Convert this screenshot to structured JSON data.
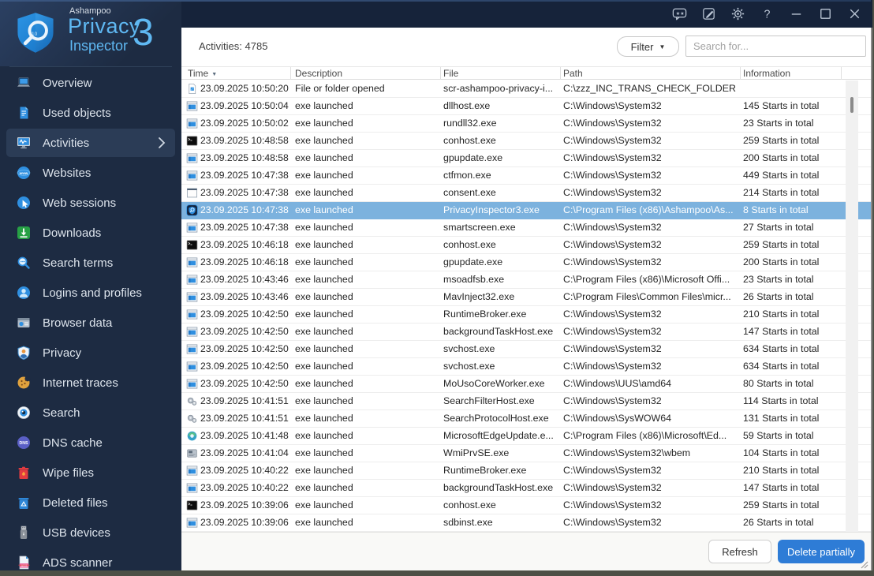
{
  "colors": {
    "accent": "#2e7cd6",
    "selected_row": "#7cb2de",
    "sidebar_bg": "#1d2b42",
    "topbar_bg": "#16233a"
  },
  "logo": {
    "brand": "Ashampoo",
    "line1": "Privacy",
    "line2": "Inspector",
    "version": "3"
  },
  "titlebar": {
    "buttons": [
      {
        "id": "feedback",
        "icon": "feedback-icon"
      },
      {
        "id": "notes",
        "icon": "notes-icon"
      },
      {
        "id": "settings",
        "icon": "gear-icon"
      },
      {
        "id": "help",
        "icon": "help-icon"
      },
      {
        "id": "minimize",
        "icon": "minimize-icon"
      },
      {
        "id": "maximize",
        "icon": "maximize-icon"
      },
      {
        "id": "close",
        "icon": "close-icon"
      }
    ]
  },
  "sidebar": {
    "items": [
      {
        "id": "overview",
        "label": "Overview",
        "icon": "laptop-icon",
        "selected": false
      },
      {
        "id": "used-objects",
        "label": "Used objects",
        "icon": "document-icon",
        "selected": false
      },
      {
        "id": "activities",
        "label": "Activities",
        "icon": "activity-monitor-icon",
        "selected": true
      },
      {
        "id": "websites",
        "label": "Websites",
        "icon": "globe-www-icon",
        "selected": false
      },
      {
        "id": "web-sessions",
        "label": "Web sessions",
        "icon": "cursor-circle-icon",
        "selected": false
      },
      {
        "id": "downloads",
        "label": "Downloads",
        "icon": "download-icon",
        "selected": false
      },
      {
        "id": "search-terms",
        "label": "Search terms",
        "icon": "magnifier-icon",
        "selected": false
      },
      {
        "id": "logins-and-profiles",
        "label": "Logins and profiles",
        "icon": "user-circle-icon",
        "selected": false
      },
      {
        "id": "browser-data",
        "label": "Browser data",
        "icon": "browser-window-icon",
        "selected": false
      },
      {
        "id": "privacy",
        "label": "Privacy",
        "icon": "shield-user-icon",
        "selected": false
      },
      {
        "id": "internet-traces",
        "label": "Internet traces",
        "icon": "cookie-icon",
        "selected": false
      },
      {
        "id": "search",
        "label": "Search",
        "icon": "eye-icon",
        "selected": false
      },
      {
        "id": "dns-cache",
        "label": "DNS cache",
        "icon": "dns-badge-icon",
        "selected": false
      },
      {
        "id": "wipe-files",
        "label": "Wipe files",
        "icon": "wipe-trash-icon",
        "selected": false
      },
      {
        "id": "deleted-files",
        "label": "Deleted files",
        "icon": "recycle-bin-icon",
        "selected": false
      },
      {
        "id": "usb-devices",
        "label": "USB devices",
        "icon": "usb-stick-icon",
        "selected": false
      },
      {
        "id": "ads-scanner",
        "label": "ADS scanner",
        "icon": "ads-document-icon",
        "selected": false
      }
    ]
  },
  "header": {
    "activities_label": "Activities: 4785",
    "filter_label": "Filter",
    "search_placeholder": "Search for..."
  },
  "icons_glyphs": {
    "sort_desc": "▼",
    "filter_caret": "▼"
  },
  "table": {
    "columns": [
      "Time",
      "Description",
      "File",
      "Path",
      "Information"
    ],
    "sort_column": "Time",
    "rows": [
      {
        "icon": "file-opened-icon",
        "time": "23.09.2025 10:50:20",
        "description": "File or folder opened",
        "file": "scr-ashampoo-privacy-i...",
        "path": "C:\\zzz_INC_TRANS_CHECK_FOLDER",
        "information": "",
        "selected": false
      },
      {
        "icon": "app-window-icon",
        "time": "23.09.2025 10:50:04",
        "description": "exe launched",
        "file": "dllhost.exe",
        "path": "C:\\Windows\\System32",
        "information": "145 Starts in total",
        "selected": false
      },
      {
        "icon": "app-window-icon",
        "time": "23.09.2025 10:50:02",
        "description": "exe launched",
        "file": "rundll32.exe",
        "path": "C:\\Windows\\System32",
        "information": "23 Starts in total",
        "selected": false
      },
      {
        "icon": "console-icon",
        "time": "23.09.2025 10:48:58",
        "description": "exe launched",
        "file": "conhost.exe",
        "path": "C:\\Windows\\System32",
        "information": "259 Starts in total",
        "selected": false
      },
      {
        "icon": "app-window-icon",
        "time": "23.09.2025 10:48:58",
        "description": "exe launched",
        "file": "gpupdate.exe",
        "path": "C:\\Windows\\System32",
        "information": "200 Starts in total",
        "selected": false
      },
      {
        "icon": "app-window-icon",
        "time": "23.09.2025 10:47:38",
        "description": "exe launched",
        "file": "ctfmon.exe",
        "path": "C:\\Windows\\System32",
        "information": "449 Starts in total",
        "selected": false
      },
      {
        "icon": "window-light-icon",
        "time": "23.09.2025 10:47:38",
        "description": "exe launched",
        "file": "consent.exe",
        "path": "C:\\Windows\\System32",
        "information": "214 Starts in total",
        "selected": false
      },
      {
        "icon": "privacy-inspector-icon",
        "time": "23.09.2025 10:47:38",
        "description": "exe launched",
        "file": "PrivacyInspector3.exe",
        "path": "C:\\Program Files (x86)\\Ashampoo\\As...",
        "information": "8 Starts in total",
        "selected": true
      },
      {
        "icon": "app-window-icon",
        "time": "23.09.2025 10:47:38",
        "description": "exe launched",
        "file": "smartscreen.exe",
        "path": "C:\\Windows\\System32",
        "information": "27 Starts in total",
        "selected": false
      },
      {
        "icon": "console-icon",
        "time": "23.09.2025 10:46:18",
        "description": "exe launched",
        "file": "conhost.exe",
        "path": "C:\\Windows\\System32",
        "information": "259 Starts in total",
        "selected": false
      },
      {
        "icon": "app-window-icon",
        "time": "23.09.2025 10:46:18",
        "description": "exe launched",
        "file": "gpupdate.exe",
        "path": "C:\\Windows\\System32",
        "information": "200 Starts in total",
        "selected": false
      },
      {
        "icon": "app-window-icon",
        "time": "23.09.2025 10:43:46",
        "description": "exe launched",
        "file": "msoadfsb.exe",
        "path": "C:\\Program Files (x86)\\Microsoft Offi...",
        "information": "23 Starts in total",
        "selected": false
      },
      {
        "icon": "app-window-icon",
        "time": "23.09.2025 10:43:46",
        "description": "exe launched",
        "file": "MavInject32.exe",
        "path": "C:\\Program Files\\Common Files\\micr...",
        "information": "26 Starts in total",
        "selected": false
      },
      {
        "icon": "app-window-icon",
        "time": "23.09.2025 10:42:50",
        "description": "exe launched",
        "file": "RuntimeBroker.exe",
        "path": "C:\\Windows\\System32",
        "information": "210 Starts in total",
        "selected": false
      },
      {
        "icon": "app-window-icon",
        "time": "23.09.2025 10:42:50",
        "description": "exe launched",
        "file": "backgroundTaskHost.exe",
        "path": "C:\\Windows\\System32",
        "information": "147 Starts in total",
        "selected": false
      },
      {
        "icon": "app-window-icon",
        "time": "23.09.2025 10:42:50",
        "description": "exe launched",
        "file": "svchost.exe",
        "path": "C:\\Windows\\System32",
        "information": "634 Starts in total",
        "selected": false
      },
      {
        "icon": "app-window-icon",
        "time": "23.09.2025 10:42:50",
        "description": "exe launched",
        "file": "svchost.exe",
        "path": "C:\\Windows\\System32",
        "information": "634 Starts in total",
        "selected": false
      },
      {
        "icon": "app-window-icon",
        "time": "23.09.2025 10:42:50",
        "description": "exe launched",
        "file": "MoUsoCoreWorker.exe",
        "path": "C:\\Windows\\UUS\\amd64",
        "information": "80 Starts in total",
        "selected": false
      },
      {
        "icon": "search-host-icon",
        "time": "23.09.2025 10:41:51",
        "description": "exe launched",
        "file": "SearchFilterHost.exe",
        "path": "C:\\Windows\\System32",
        "information": "114 Starts in total",
        "selected": false
      },
      {
        "icon": "search-host-icon",
        "time": "23.09.2025 10:41:51",
        "description": "exe launched",
        "file": "SearchProtocolHost.exe",
        "path": "C:\\Windows\\SysWOW64",
        "information": "131 Starts in total",
        "selected": false
      },
      {
        "icon": "edge-update-icon",
        "time": "23.09.2025 10:41:48",
        "description": "exe launched",
        "file": "MicrosoftEdgeUpdate.e...",
        "path": "C:\\Program Files (x86)\\Microsoft\\Ed...",
        "information": "59 Starts in total",
        "selected": false
      },
      {
        "icon": "wmi-icon",
        "time": "23.09.2025 10:41:04",
        "description": "exe launched",
        "file": "WmiPrvSE.exe",
        "path": "C:\\Windows\\System32\\wbem",
        "information": "104 Starts in total",
        "selected": false
      },
      {
        "icon": "app-window-icon",
        "time": "23.09.2025 10:40:22",
        "description": "exe launched",
        "file": "RuntimeBroker.exe",
        "path": "C:\\Windows\\System32",
        "information": "210 Starts in total",
        "selected": false
      },
      {
        "icon": "app-window-icon",
        "time": "23.09.2025 10:40:22",
        "description": "exe launched",
        "file": "backgroundTaskHost.exe",
        "path": "C:\\Windows\\System32",
        "information": "147 Starts in total",
        "selected": false
      },
      {
        "icon": "console-icon",
        "time": "23.09.2025 10:39:06",
        "description": "exe launched",
        "file": "conhost.exe",
        "path": "C:\\Windows\\System32",
        "information": "259 Starts in total",
        "selected": false
      },
      {
        "icon": "app-window-icon",
        "time": "23.09.2025 10:39:06",
        "description": "exe launched",
        "file": "sdbinst.exe",
        "path": "C:\\Windows\\System32",
        "information": "26 Starts in total",
        "selected": false
      }
    ]
  },
  "footer": {
    "refresh_label": "Refresh",
    "delete_label": "Delete partially"
  }
}
